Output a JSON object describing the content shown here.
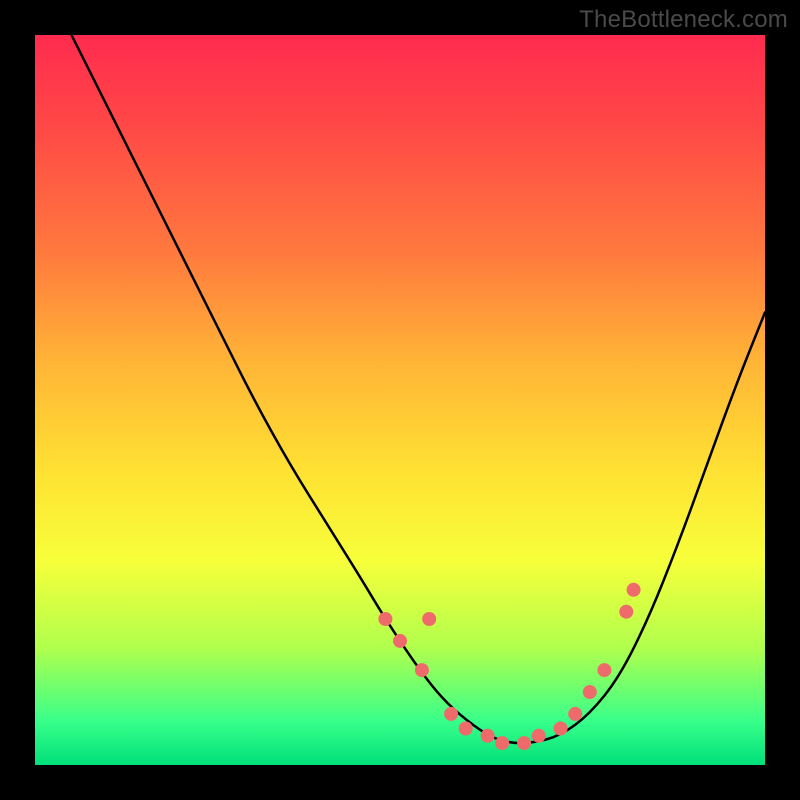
{
  "watermark": "TheBottleneck.com",
  "chart_data": {
    "type": "line",
    "title": "",
    "xlabel": "",
    "ylabel": "",
    "xlim": [
      0,
      100
    ],
    "ylim": [
      0,
      100
    ],
    "grid": false,
    "legend": false,
    "background_gradient": {
      "orientation": "vertical",
      "stops": [
        {
          "pos": 0,
          "color": "#ff2b4f"
        },
        {
          "pos": 12,
          "color": "#ff4747"
        },
        {
          "pos": 30,
          "color": "#ff7a3e"
        },
        {
          "pos": 45,
          "color": "#ffb536"
        },
        {
          "pos": 60,
          "color": "#ffe233"
        },
        {
          "pos": 72,
          "color": "#f7ff3a"
        },
        {
          "pos": 84,
          "color": "#b0ff4d"
        },
        {
          "pos": 94,
          "color": "#38ff8a"
        },
        {
          "pos": 100,
          "color": "#00e07a"
        }
      ]
    },
    "series": [
      {
        "name": "bottleneck-curve",
        "color": "#000000",
        "x": [
          5,
          10,
          15,
          20,
          25,
          30,
          35,
          40,
          45,
          48,
          52,
          55,
          58,
          62,
          65,
          68,
          72,
          76,
          80,
          84,
          88,
          92,
          96,
          100
        ],
        "y": [
          100,
          90,
          80,
          70,
          60,
          50,
          41,
          33,
          25,
          20,
          14,
          10,
          7,
          4,
          3,
          3,
          4,
          7,
          12,
          20,
          30,
          41,
          52,
          62
        ]
      }
    ],
    "markers": {
      "name": "highlight-dots",
      "color": "#ef6b6b",
      "radius": 7,
      "points": [
        {
          "x": 48,
          "y": 20
        },
        {
          "x": 50,
          "y": 17
        },
        {
          "x": 53,
          "y": 13
        },
        {
          "x": 54,
          "y": 20
        },
        {
          "x": 57,
          "y": 7
        },
        {
          "x": 59,
          "y": 5
        },
        {
          "x": 62,
          "y": 4
        },
        {
          "x": 64,
          "y": 3
        },
        {
          "x": 67,
          "y": 3
        },
        {
          "x": 69,
          "y": 4
        },
        {
          "x": 72,
          "y": 5
        },
        {
          "x": 74,
          "y": 7
        },
        {
          "x": 76,
          "y": 10
        },
        {
          "x": 78,
          "y": 13
        },
        {
          "x": 81,
          "y": 21
        },
        {
          "x": 82,
          "y": 24
        }
      ]
    }
  }
}
